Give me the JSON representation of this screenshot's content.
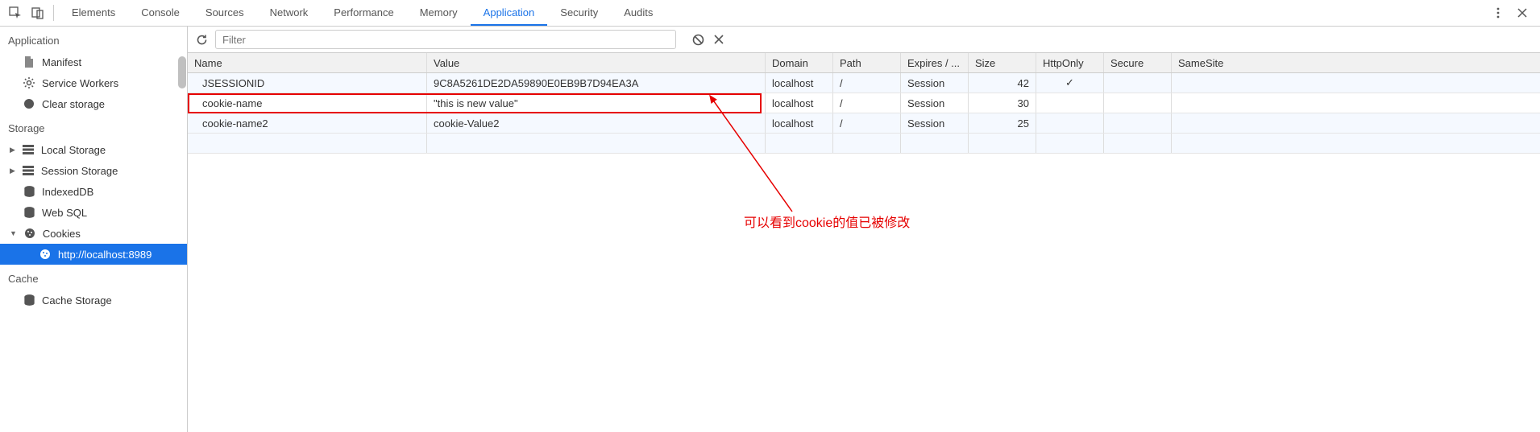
{
  "tabs": [
    "Elements",
    "Console",
    "Sources",
    "Network",
    "Performance",
    "Memory",
    "Application",
    "Security",
    "Audits"
  ],
  "active_tab": "Application",
  "sidebar": {
    "sections": [
      {
        "title": "Application",
        "items": [
          {
            "label": "Manifest",
            "icon": "document-icon"
          },
          {
            "label": "Service Workers",
            "icon": "gear-icon"
          },
          {
            "label": "Clear storage",
            "icon": "clear-icon"
          }
        ]
      },
      {
        "title": "Storage",
        "items": [
          {
            "label": "Local Storage",
            "icon": "storage-icon",
            "expandable": true
          },
          {
            "label": "Session Storage",
            "icon": "storage-icon",
            "expandable": true
          },
          {
            "label": "IndexedDB",
            "icon": "db-icon"
          },
          {
            "label": "Web SQL",
            "icon": "db-icon"
          },
          {
            "label": "Cookies",
            "icon": "cookie-icon",
            "expandable": true,
            "expanded": true,
            "children": [
              {
                "label": "http://localhost:8989",
                "icon": "cookie-icon",
                "selected": true
              }
            ]
          }
        ]
      },
      {
        "title": "Cache",
        "items": [
          {
            "label": "Cache Storage",
            "icon": "db-icon"
          }
        ]
      }
    ]
  },
  "toolbar": {
    "filter_placeholder": "Filter"
  },
  "columns": [
    "Name",
    "Value",
    "Domain",
    "Path",
    "Expires / ...",
    "Size",
    "HttpOnly",
    "Secure",
    "SameSite"
  ],
  "cookies": [
    {
      "name": "JSESSIONID",
      "value": "9C8A5261DE2DA59890E0EB9B7D94EA3A",
      "domain": "localhost",
      "path": "/",
      "expires": "Session",
      "size": "42",
      "httponly": "✓",
      "secure": "",
      "samesite": "",
      "highlighted": false
    },
    {
      "name": "cookie-name",
      "value": "\"this is new value\"",
      "domain": "localhost",
      "path": "/",
      "expires": "Session",
      "size": "30",
      "httponly": "",
      "secure": "",
      "samesite": "",
      "highlighted": true
    },
    {
      "name": "cookie-name2",
      "value": "cookie-Value2",
      "domain": "localhost",
      "path": "/",
      "expires": "Session",
      "size": "25",
      "httponly": "",
      "secure": "",
      "samesite": "",
      "highlighted": false
    }
  ],
  "annotation_text": "可以看到cookie的值已被修改"
}
